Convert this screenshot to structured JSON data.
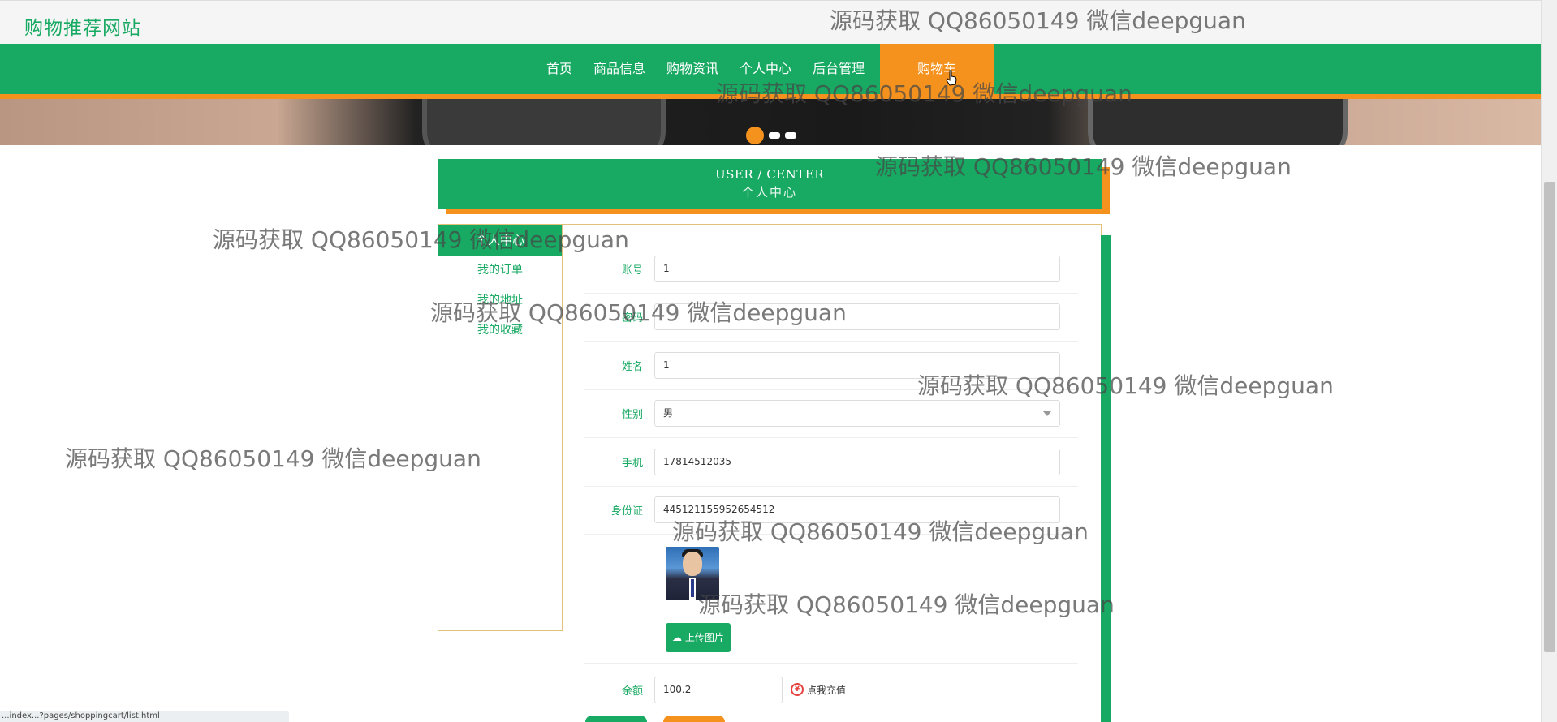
{
  "site": {
    "title": "购物推荐网站"
  },
  "nav": {
    "items": [
      "首页",
      "商品信息",
      "购物资讯",
      "个人中心",
      "后台管理"
    ],
    "active": "购物车"
  },
  "center": {
    "en_title": "USER / CENTER",
    "cn_title": "个人中心"
  },
  "side_menu": {
    "header": "个人中心",
    "items": [
      "我的订单",
      "我的地址",
      "我的收藏"
    ]
  },
  "form": {
    "account": {
      "label": "账号",
      "value": "1"
    },
    "password": {
      "label": "密码",
      "value": ""
    },
    "name": {
      "label": "姓名",
      "value": "1"
    },
    "gender": {
      "label": "性别",
      "value": "男"
    },
    "phone": {
      "label": "手机",
      "value": "17814512035"
    },
    "id_card": {
      "label": "身份证",
      "value": "445121155952654512"
    },
    "upload_label": "上传图片",
    "balance": {
      "label": "余额",
      "value": "100.2"
    },
    "recharge_label": "点我充值"
  },
  "status_url": "...index...?pages/shoppingcart/list.html",
  "watermark_text": "源码获取 QQ86050149 微信deepguan",
  "colors": {
    "primary": "#18a963",
    "accent": "#f5921e"
  },
  "icons": {
    "upload": "cloud-upload-icon",
    "recharge": "yuan-coin-icon",
    "cursor": "hand-pointer-icon"
  }
}
